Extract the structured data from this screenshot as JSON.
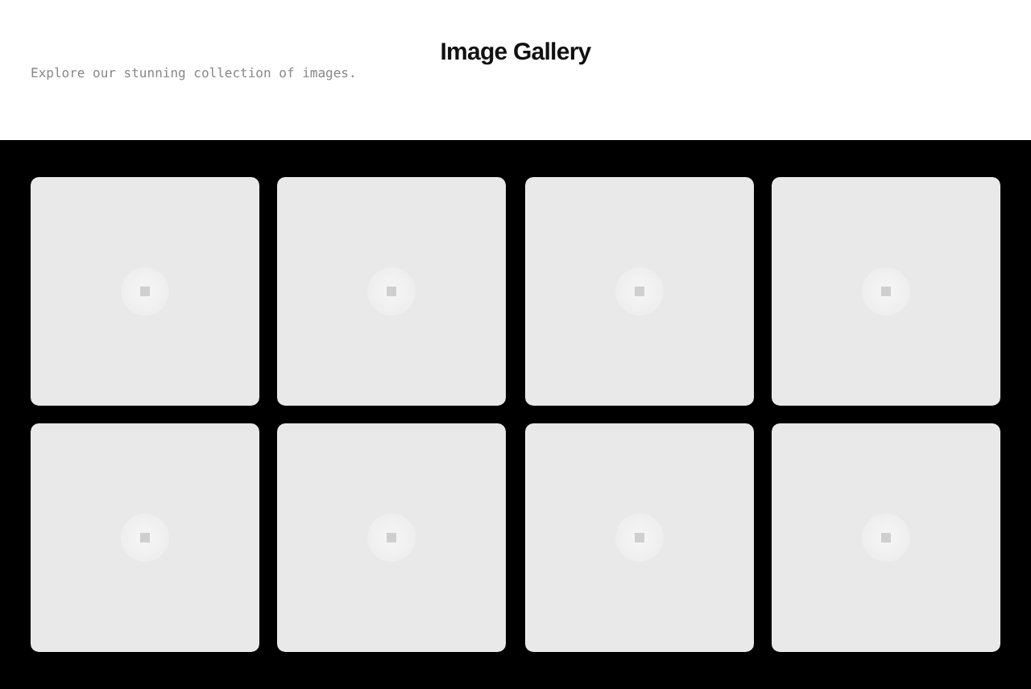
{
  "header": {
    "title": "Image Gallery",
    "subtitle": "Explore our stunning collection of images."
  },
  "images": [
    {
      "kind": "placeholder"
    },
    {
      "kind": "placeholder"
    },
    {
      "kind": "placeholder"
    },
    {
      "kind": "placeholder"
    },
    {
      "kind": "placeholder"
    },
    {
      "kind": "placeholder"
    },
    {
      "kind": "placeholder"
    },
    {
      "kind": "placeholder"
    }
  ]
}
